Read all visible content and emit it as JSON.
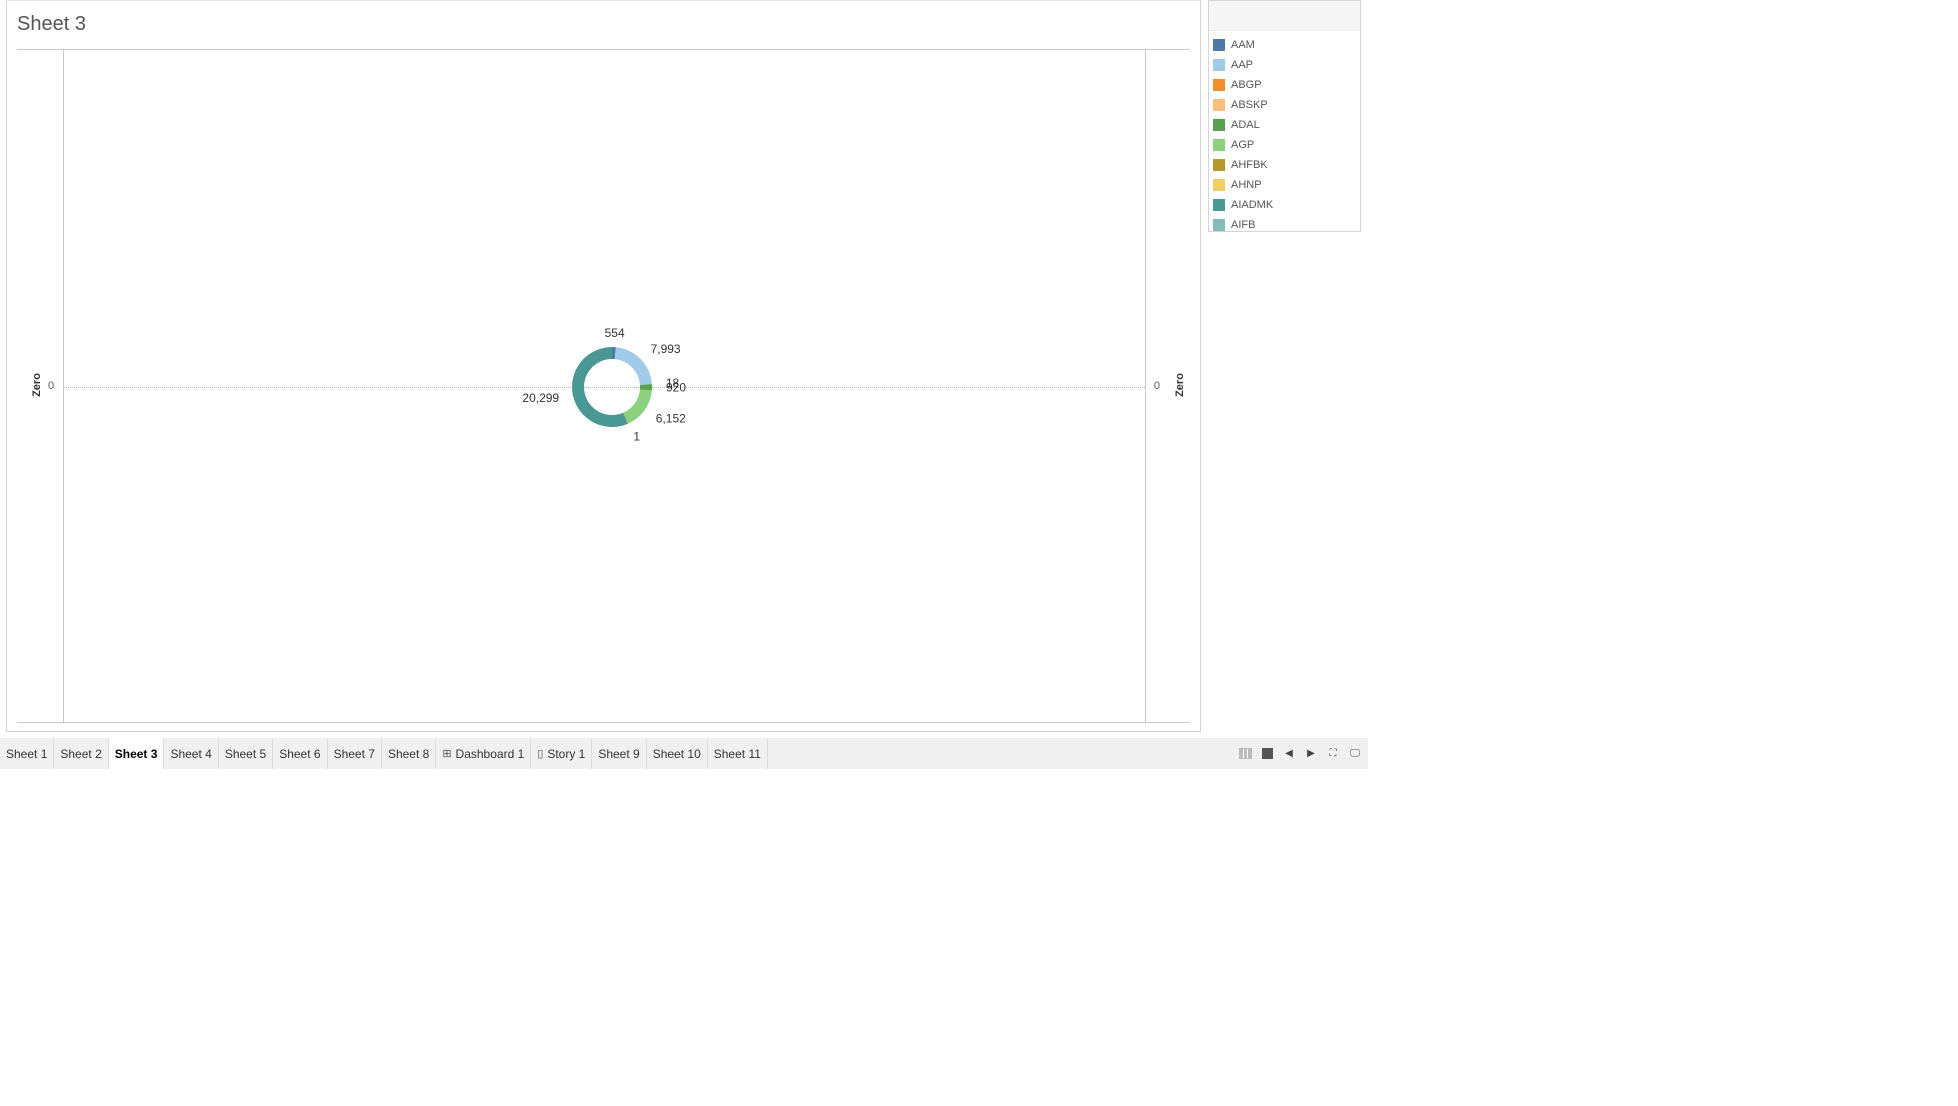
{
  "sheet": {
    "title": "Sheet 3",
    "axis_title_left": "Zero",
    "axis_title_right": "Zero",
    "axis_tick_left": "0",
    "axis_tick_right": "0"
  },
  "chart_data": {
    "type": "pie",
    "labels_shown": [
      "554",
      "18",
      "7,993",
      "920",
      "6,152",
      "1",
      "20,299"
    ],
    "slices": [
      {
        "party": "AAM",
        "value": 554,
        "label": "554",
        "color": "#4e79a7"
      },
      {
        "party": "AAP",
        "value": 7993,
        "label": "7,993",
        "color": "#a0cbe8"
      },
      {
        "party": "ABGP",
        "value": 18,
        "label": "18",
        "color": "#f28e2b"
      },
      {
        "party": "ADAL",
        "value": 920,
        "label": "920",
        "color": "#59a14f"
      },
      {
        "party": "AGP",
        "value": 6152,
        "label": "6,152",
        "color": "#8cd17d"
      },
      {
        "party": "AHFBK",
        "value": 1,
        "label": "1",
        "color": "#b6992d"
      },
      {
        "party": "AIADMK",
        "value": 20299,
        "label": "20,299",
        "color": "#499894"
      }
    ],
    "donut": true
  },
  "legend": {
    "items": [
      {
        "label": "AAM",
        "color": "#4e79a7"
      },
      {
        "label": "AAP",
        "color": "#a0cbe8"
      },
      {
        "label": "ABGP",
        "color": "#f28e2b"
      },
      {
        "label": "ABSKP",
        "color": "#ffbe7d"
      },
      {
        "label": "ADAL",
        "color": "#59a14f"
      },
      {
        "label": "AGP",
        "color": "#8cd17d"
      },
      {
        "label": "AHFBK",
        "color": "#b6992d"
      },
      {
        "label": "AHNP",
        "color": "#f1ce63"
      },
      {
        "label": "AIADMK",
        "color": "#499894"
      },
      {
        "label": "AIFB",
        "color": "#86bcb6"
      }
    ]
  },
  "tabs": [
    {
      "label": "Sheet 1",
      "icon": ""
    },
    {
      "label": "Sheet 2",
      "icon": ""
    },
    {
      "label": "Sheet 3",
      "icon": "",
      "active": true
    },
    {
      "label": "Sheet 4",
      "icon": ""
    },
    {
      "label": "Sheet 5",
      "icon": ""
    },
    {
      "label": "Sheet 6",
      "icon": ""
    },
    {
      "label": "Sheet 7",
      "icon": ""
    },
    {
      "label": "Sheet 8",
      "icon": ""
    },
    {
      "label": "Dashboard 1",
      "icon": "dashboard-icon"
    },
    {
      "label": "Story 1",
      "icon": "story-icon"
    },
    {
      "label": "Sheet 9",
      "icon": ""
    },
    {
      "label": "Sheet 10",
      "icon": ""
    },
    {
      "label": "Sheet 11",
      "icon": ""
    }
  ],
  "controls": [
    "show-sheet-sorter-icon",
    "show-filmstrip-icon",
    "previous-tab-icon",
    "next-tab-icon",
    "fullscreen-icon",
    "presentation-mode-icon"
  ]
}
